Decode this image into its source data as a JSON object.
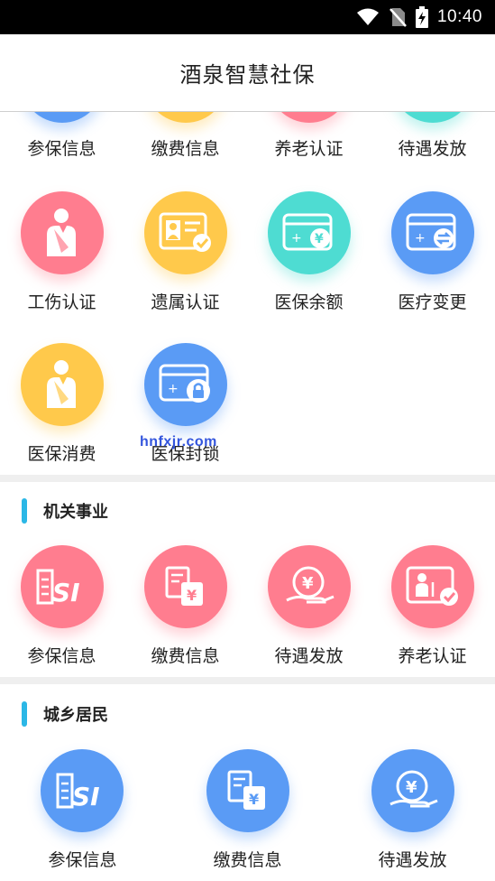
{
  "status_bar": {
    "time": "10:40"
  },
  "header": {
    "title": "酒泉智慧社保"
  },
  "top_row": [
    {
      "label": "参保信息",
      "color": "#5a9bf5"
    },
    {
      "label": "缴费信息",
      "color": "#ffc94b"
    },
    {
      "label": "养老认证",
      "color": "#ff7d8f"
    },
    {
      "label": "待遇发放",
      "color": "#4edcd2"
    }
  ],
  "grid_row_2": [
    {
      "label": "工伤认证",
      "icon": "injured-person-icon"
    },
    {
      "label": "遗属认证",
      "icon": "id-card-check-icon"
    },
    {
      "label": "医保余额",
      "icon": "card-yuan-icon"
    },
    {
      "label": "医疗变更",
      "icon": "card-exchange-icon"
    }
  ],
  "grid_row_3": [
    {
      "label": "医保消费",
      "icon": "injured-person-icon"
    },
    {
      "label": "医保封锁",
      "icon": "card-lock-icon"
    }
  ],
  "watermark": "hnfxjr.com",
  "sections": [
    {
      "title": "机关事业",
      "items": [
        {
          "label": "参保信息",
          "icon": "si-document-icon"
        },
        {
          "label": "缴费信息",
          "icon": "payment-document-icon"
        },
        {
          "label": "待遇发放",
          "icon": "hand-yuan-icon"
        },
        {
          "label": "养老认证",
          "icon": "elder-card-check-icon"
        }
      ]
    },
    {
      "title": "城乡居民",
      "items": [
        {
          "label": "参保信息",
          "icon": "si-document-icon"
        },
        {
          "label": "缴费信息",
          "icon": "payment-document-icon"
        },
        {
          "label": "待遇发放",
          "icon": "hand-yuan-icon"
        }
      ]
    }
  ]
}
